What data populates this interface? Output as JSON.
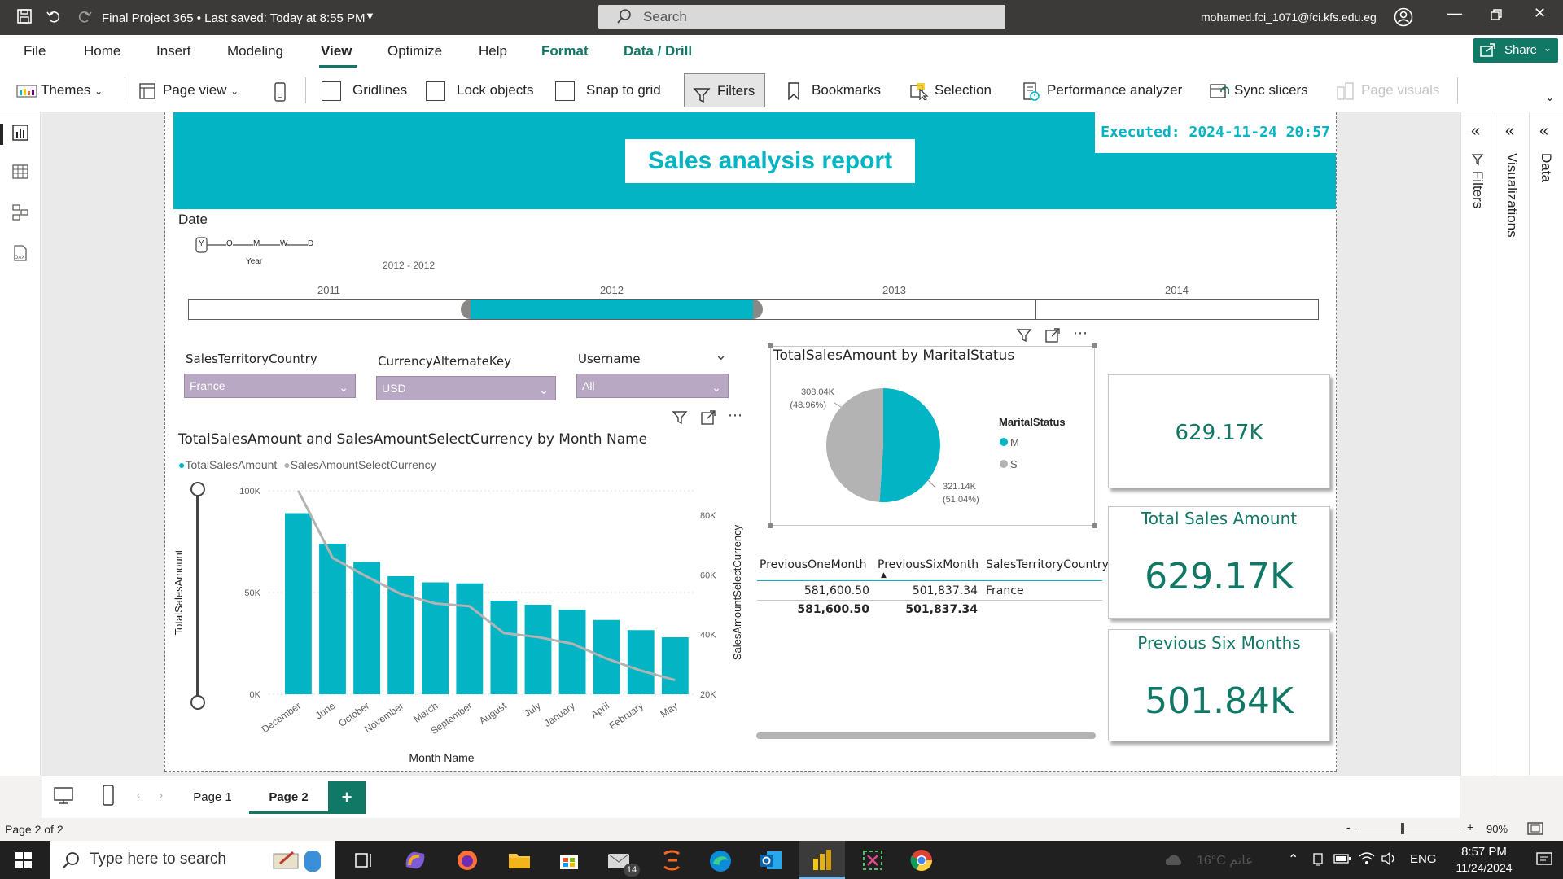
{
  "titlebar": {
    "title": "Final Project 365 • Last saved: Today at 8:55 PM",
    "search_placeholder": "Search",
    "user": "mohamed.fci_1071@fci.kfs.edu.eg"
  },
  "menu": {
    "items": [
      "File",
      "Home",
      "Insert",
      "Modeling",
      "View",
      "Optimize",
      "Help",
      "Format",
      "Data / Drill"
    ],
    "share_label": "Share"
  },
  "ribbon": {
    "themes": "Themes",
    "page_view": "Page view",
    "gridlines": "Gridlines",
    "lock_objects": "Lock objects",
    "snap_to_grid": "Snap to grid",
    "filters": "Filters",
    "bookmarks": "Bookmarks",
    "selection": "Selection",
    "performance_analyzer": "Performance analyzer",
    "sync_slicers": "Sync slicers",
    "page_visuals": "Page visuals"
  },
  "panes": {
    "filters": "Filters",
    "visualizations": "Visualizations",
    "data": "Data"
  },
  "report": {
    "title": "Sales analysis report",
    "executed": "Executed: 2024-11-24 20:57",
    "colors": {
      "accent": "#02b4c4",
      "teal_text": "#117865",
      "grey_series": "#b3b3b3",
      "slicer_fill": "#b9a8c3"
    }
  },
  "date_slicer": {
    "title": "Date",
    "levels": [
      "Y",
      "Q",
      "M",
      "W",
      "D"
    ],
    "level_label": "Year",
    "range_text": "2012 - 2012",
    "years": [
      "2011",
      "2012",
      "2013",
      "2014"
    ],
    "selected_year": "2012"
  },
  "slicers": [
    {
      "title": "SalesTerritoryCountry",
      "value": "France"
    },
    {
      "title": "CurrencyAlternateKey",
      "value": "USD"
    },
    {
      "title": "Username",
      "value": "All"
    }
  ],
  "combo_chart": {
    "title": "TotalSalesAmount and SalesAmountSelectCurrency by Month Name",
    "legend": [
      "TotalSalesAmount",
      "SalesAmountSelectCurrency"
    ],
    "xlabel": "Month Name",
    "ylabel_left": "TotalSalesAmount",
    "ylabel_right": "SalesAmountSelectCurrency",
    "left_ticks": [
      "100K",
      "50K",
      "0K"
    ],
    "right_ticks": [
      "80K",
      "60K",
      "40K",
      "20K"
    ]
  },
  "pie_chart": {
    "title": "TotalSalesAmount by MaritalStatus",
    "legend_title": "MaritalStatus",
    "slices": [
      {
        "label": "M",
        "value_text": "321.14K",
        "pct_text": "(51.04%)"
      },
      {
        "label": "S",
        "value_text": "308.04K",
        "pct_text": "(48.96%)"
      }
    ]
  },
  "table": {
    "headers": [
      "PreviousOneMonth",
      "PreviousSixMonth",
      "SalesTerritoryCountry"
    ],
    "row": [
      "581,600.50",
      "501,837.34",
      "France"
    ],
    "total": [
      "581,600.50",
      "501,837.34",
      ""
    ]
  },
  "cards": [
    {
      "label": "",
      "value": "629.17K"
    },
    {
      "label": "Total Sales Amount",
      "value": "629.17K"
    },
    {
      "label": "Previous Six Months",
      "value": "501.84K"
    }
  ],
  "pages": {
    "tabs": [
      "Page 1",
      "Page 2"
    ],
    "active": "Page 2",
    "add_label": "+"
  },
  "statusbar": {
    "page_info": "Page 2 of 2",
    "zoom": "90%"
  },
  "taskbar": {
    "search_placeholder": "Type here to search",
    "weather": "16°C عاتم",
    "lang": "ENG",
    "time": "8:57 PM",
    "date": "11/24/2024",
    "mail_badge": "14"
  },
  "chart_data": [
    {
      "type": "bar",
      "title": "TotalSalesAmount and SalesAmountSelectCurrency by Month Name",
      "categories": [
        "December",
        "June",
        "October",
        "November",
        "March",
        "September",
        "August",
        "July",
        "January",
        "April",
        "February",
        "May"
      ],
      "series": [
        {
          "name": "TotalSalesAmount",
          "type": "bar",
          "axis": "left",
          "color": "#02b4c4",
          "values": [
            89000,
            74000,
            65000,
            58000,
            55000,
            54500,
            46000,
            44000,
            41500,
            36500,
            31500,
            28000
          ]
        },
        {
          "name": "SalesAmountSelectCurrency",
          "type": "line",
          "axis": "right",
          "color": "#b3b3b3",
          "values": [
            89000,
            73000,
            66000,
            59500,
            56000,
            55000,
            45000,
            43500,
            41000,
            35500,
            31000,
            27500
          ]
        }
      ],
      "xlabel": "Month Name",
      "ylabel": "TotalSalesAmount",
      "ylim": [
        0,
        100000
      ],
      "y2label": "SalesAmountSelectCurrency",
      "y2lim": [
        20000,
        90000
      ]
    },
    {
      "type": "pie",
      "title": "TotalSalesAmount by MaritalStatus",
      "categories": [
        "M",
        "S"
      ],
      "values": [
        321140,
        308040
      ],
      "colors": [
        "#02b4c4",
        "#b3b3b3"
      ]
    }
  ]
}
